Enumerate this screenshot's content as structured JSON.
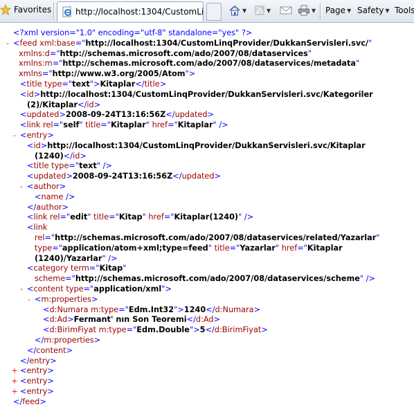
{
  "toolbar": {
    "favorites_label": "Favorites",
    "tab_title": "http://localhost:1304/CustomLinqPr...",
    "page_label": "Page",
    "safety_label": "Safety",
    "tools_label": "Tools",
    "icons": [
      "star-icon",
      "ie-page-icon",
      "home-icon",
      "rss-feed-icon",
      "mail-icon",
      "print-icon"
    ]
  },
  "xml": {
    "decl": "<?xml version=\"1.0\" encoding=\"utf-8\" standalone=\"yes\" ?>",
    "feed_base_attr": "xml:base",
    "feed_base": "http://localhost:1304/CustomLinqProvider/DukkanServisleri.svc/",
    "ns_d_attr": "xmlns:d",
    "ns_d": "http://schemas.microsoft.com/ado/2007/08/dataservices",
    "ns_m_attr": "xmlns:m",
    "ns_m": "http://schemas.microsoft.com/ado/2007/08/dataservices/metadata",
    "ns_attr": "xmlns",
    "ns": "http://www.w3.org/2005/Atom",
    "feed_title_type": "text",
    "feed_title": "Kitaplar",
    "feed_id_1": "http://localhost:1304/CustomLinqProvider/DukkanServisleri.svc/Kategoriler",
    "feed_id_2": "(2)/Kitaplar",
    "feed_updated": "2008-09-24T13:16:56Z",
    "feed_link_rel": "self",
    "feed_link_title": "Kitaplar",
    "feed_link_href": "Kitaplar",
    "entry_id_1": "http://localhost:1304/CustomLinqProvider/DukkanServisleri.svc/Kitaplar",
    "entry_id_2": "(1240)",
    "entry_title_type": "text",
    "entry_updated": "2008-09-24T13:16:56Z",
    "edit_rel": "edit",
    "edit_title": "Kitap",
    "edit_href": "Kitaplar(1240)",
    "rel_link_rel": "http://schemas.microsoft.com/ado/2007/08/dataservices/related/Yazarlar",
    "rel_link_type": "application/atom+xml;type=feed",
    "rel_link_title": "Yazarlar",
    "rel_link_href_1": "Kitaplar",
    "rel_link_href_2": "(1240)/Yazarlar",
    "category_term": "Kitap",
    "category_scheme": "http://schemas.microsoft.com/ado/2007/08/dataservices/scheme",
    "content_type": "application/xml",
    "numara_type": "Edm.Int32",
    "numara": "1240",
    "ad": "Fermant' nın Son Teoremi",
    "fiyat_type": "Edm.Double",
    "fiyat": "5"
  },
  "colors": {
    "markup": "#0000ff",
    "tag_name": "#990000",
    "value": "#000000",
    "toggle": "#ff0000"
  }
}
